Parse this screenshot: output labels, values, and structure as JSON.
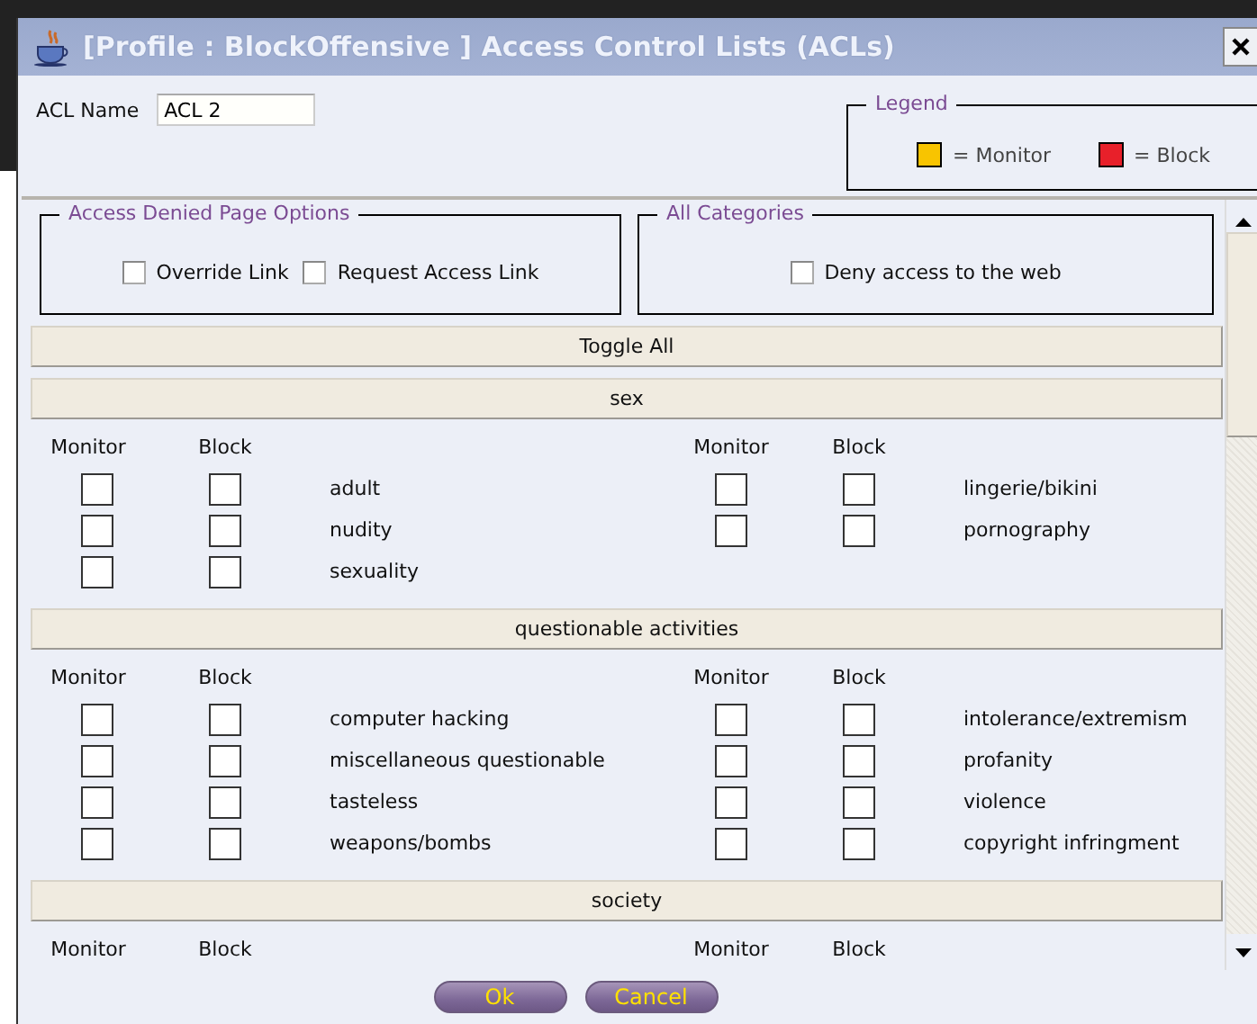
{
  "window": {
    "title": "[Profile : BlockOffensive ] Access Control Lists (ACLs)"
  },
  "acl_name": {
    "label": "ACL Name",
    "value": "ACL 2"
  },
  "legend": {
    "title": "Legend",
    "items": [
      {
        "color": "#f8c400",
        "label": "= Monitor"
      },
      {
        "color": "#e8202a",
        "label": "= Block"
      }
    ]
  },
  "access_denied_options": {
    "title": "Access Denied Page Options",
    "options": [
      {
        "label": "Override Link",
        "checked": false
      },
      {
        "label": "Request Access Link",
        "checked": false
      }
    ]
  },
  "all_categories": {
    "title": "All Categories",
    "options": [
      {
        "label": "Deny access to the web",
        "checked": false
      }
    ]
  },
  "toggle_all": "Toggle All",
  "groups": [
    {
      "title": "sex",
      "headers": [
        "Monitor",
        "Block",
        "Monitor",
        "Block"
      ],
      "categories": [
        {
          "name": "adult",
          "monitor": false,
          "block": false
        },
        {
          "name": "lingerie/bikini",
          "monitor": false,
          "block": false
        },
        {
          "name": "nudity",
          "monitor": false,
          "block": false
        },
        {
          "name": "pornography",
          "monitor": false,
          "block": false
        },
        {
          "name": "sexuality",
          "monitor": false,
          "block": false
        }
      ]
    },
    {
      "title": "questionable activities",
      "headers": [
        "Monitor",
        "Block",
        "Monitor",
        "Block"
      ],
      "categories": [
        {
          "name": "computer hacking",
          "monitor": false,
          "block": false
        },
        {
          "name": "intolerance/extremism",
          "monitor": false,
          "block": false
        },
        {
          "name": "miscellaneous questionable",
          "monitor": false,
          "block": false
        },
        {
          "name": "profanity",
          "monitor": false,
          "block": false
        },
        {
          "name": "tasteless",
          "monitor": false,
          "block": false
        },
        {
          "name": "violence",
          "monitor": false,
          "block": false
        },
        {
          "name": "weapons/bombs",
          "monitor": false,
          "block": false
        },
        {
          "name": "copyright infringment",
          "monitor": false,
          "block": false
        }
      ]
    },
    {
      "title": "society",
      "headers": [
        "Monitor",
        "Block",
        "Monitor",
        "Block"
      ]
    }
  ],
  "buttons": [
    "Ok",
    "Cancel"
  ]
}
